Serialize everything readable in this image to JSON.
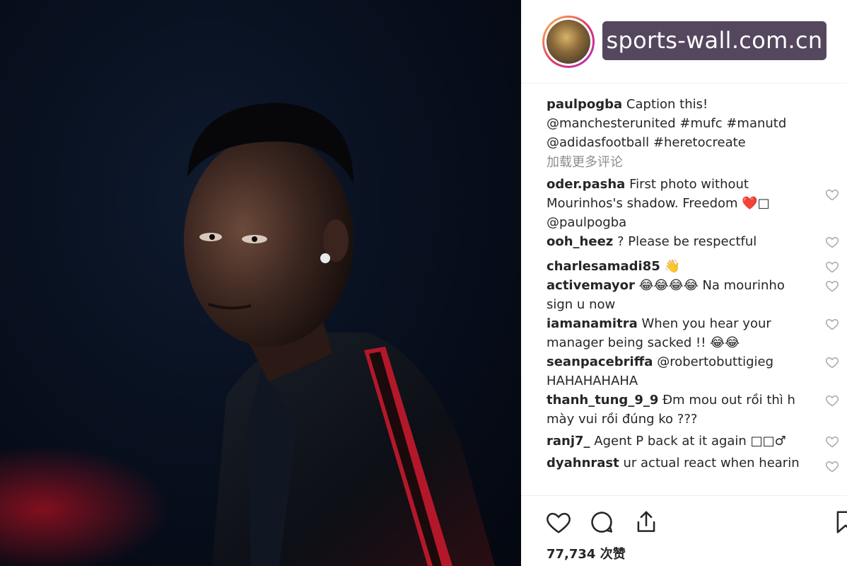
{
  "watermark": "sports-wall.com.cn",
  "post": {
    "username": "paulpogba",
    "caption_lines": [
      "Caption this!",
      "@manchesterunited #mufc #manutd",
      "@adidasfootball #heretocreate"
    ],
    "load_more": "加载更多评论"
  },
  "comments": [
    {
      "user": "oder.pasha",
      "lines": [
        "First photo without",
        "Mourinhos's shadow. Freedom ❤️□",
        "@paulpogba"
      ]
    },
    {
      "user": "ooh_heez",
      "lines": [
        "? Please be respectful"
      ]
    },
    {
      "user": "charlesamadi85",
      "lines": [
        "👋"
      ]
    },
    {
      "user": "activemayor",
      "lines": [
        "😂😂😂😂 Na mourinho",
        "sign u now"
      ]
    },
    {
      "user": "iamanamitra",
      "lines": [
        "When you hear your",
        "manager being sacked !! 😂😂"
      ]
    },
    {
      "user": "seanpacebriffa",
      "lines": [
        "@robertobuttigieg",
        "HAHAHAHAHA"
      ]
    },
    {
      "user": "thanh_tung_9_9",
      "lines": [
        "Đm mou out rồi thì h",
        "mày vui rồi đúng ko ???"
      ]
    },
    {
      "user": "ranj7_",
      "lines": [
        "Agent P back at it again □□♂"
      ]
    },
    {
      "user": "dyahnrast",
      "lines": [
        "ur actual react when hearin"
      ]
    }
  ],
  "likes_text": "77,734 次赞",
  "icons": {
    "like": "heart-icon",
    "comment": "comment-icon",
    "share": "share-icon",
    "save": "bookmark-icon",
    "comment_like": "heart-icon"
  },
  "colors": {
    "text": "#262626",
    "muted": "#8e8e8e",
    "watermark_bg": "#55485e",
    "jacket_stripe": "#b3182a"
  }
}
